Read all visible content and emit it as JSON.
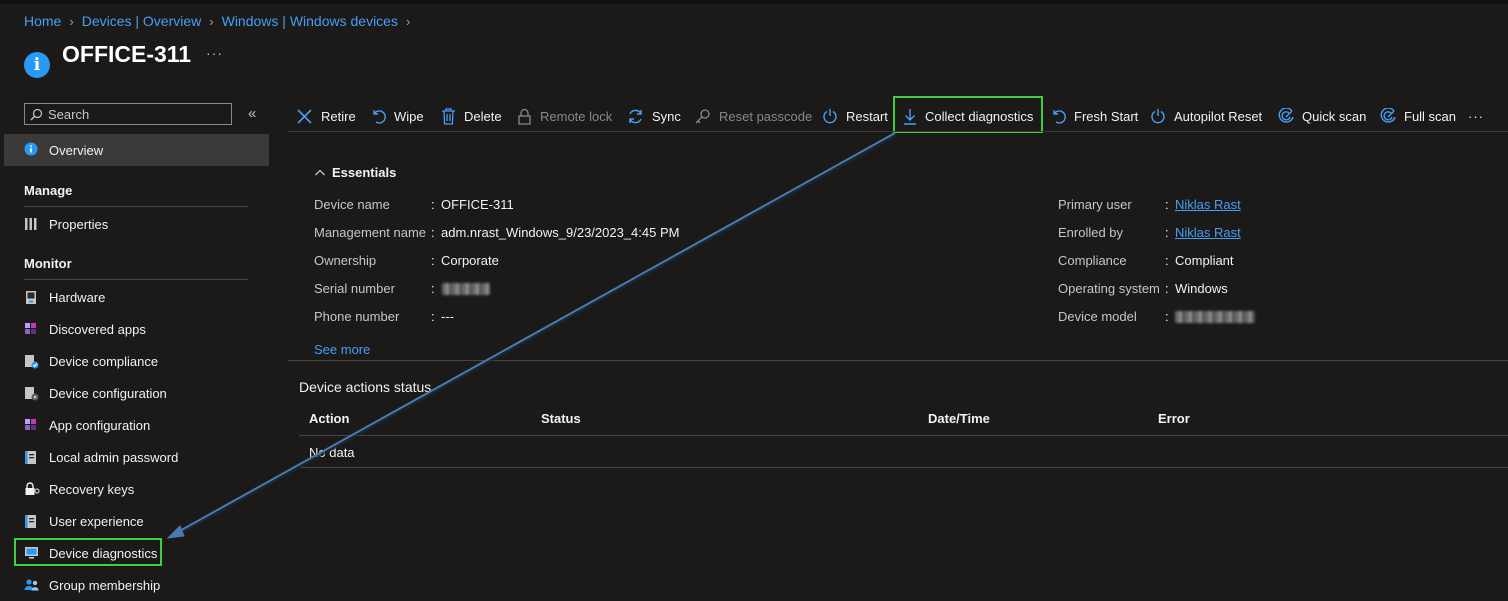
{
  "breadcrumb": [
    "Home",
    "Devices | Overview",
    "Windows | Windows devices"
  ],
  "page": {
    "title": "OFFICE-311",
    "more": "···"
  },
  "sidebar": {
    "search_placeholder": "Search",
    "collapse": "«",
    "overview": "Overview",
    "manage_header": "Manage",
    "properties": "Properties",
    "monitor_header": "Monitor",
    "monitor_items": [
      {
        "label": "Hardware",
        "icon": "hardware-icon"
      },
      {
        "label": "Discovered apps",
        "icon": "apps-icon"
      },
      {
        "label": "Device compliance",
        "icon": "compliance-icon"
      },
      {
        "label": "Device configuration",
        "icon": "configuration-icon"
      },
      {
        "label": "App configuration",
        "icon": "app-configuration-icon"
      },
      {
        "label": "Local admin password",
        "icon": "password-icon"
      },
      {
        "label": "Recovery keys",
        "icon": "lock-icon"
      },
      {
        "label": "User experience",
        "icon": "user-experience-icon"
      },
      {
        "label": "Device diagnostics",
        "icon": "diagnostics-icon"
      },
      {
        "label": "Group membership",
        "icon": "group-icon"
      }
    ]
  },
  "toolbar": {
    "retire": "Retire",
    "wipe": "Wipe",
    "delete": "Delete",
    "remote_lock": "Remote lock",
    "sync": "Sync",
    "reset_passcode": "Reset passcode",
    "restart": "Restart",
    "collect_diagnostics": "Collect diagnostics",
    "fresh_start": "Fresh Start",
    "autopilot_reset": "Autopilot Reset",
    "quick_scan": "Quick scan",
    "full_scan": "Full scan",
    "more": "···"
  },
  "essentials": {
    "title": "Essentials",
    "left": [
      {
        "label": "Device name",
        "value": "OFFICE-311"
      },
      {
        "label": "Management name",
        "value": "adm.nrast_Windows_9/23/2023_4:45 PM"
      },
      {
        "label": "Ownership",
        "value": "Corporate"
      },
      {
        "label": "Serial number",
        "value": ""
      },
      {
        "label": "Phone number",
        "value": "---"
      }
    ],
    "right": [
      {
        "label": "Primary user",
        "value": "Niklas Rast"
      },
      {
        "label": "Enrolled by",
        "value": "Niklas Rast"
      },
      {
        "label": "Compliance",
        "value": "Compliant"
      },
      {
        "label": "Operating system",
        "value": "Windows"
      },
      {
        "label": "Device model",
        "value": ""
      }
    ],
    "see_more": "See more"
  },
  "actions_status": {
    "title": "Device actions status",
    "columns": [
      "Action",
      "Status",
      "Date/Time",
      "Error"
    ],
    "empty": "No data"
  },
  "colors": {
    "accent": "#2899f5",
    "link": "#479ef5",
    "highlight": "#3fcf3f",
    "annotation_arrow": "#4a7ab0"
  }
}
